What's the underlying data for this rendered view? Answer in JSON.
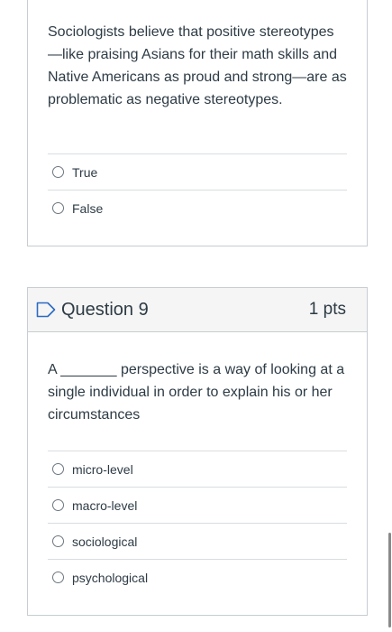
{
  "question8": {
    "text": "Sociologists believe that positive stereotypes —like praising Asians for their math skills and Native Americans as proud and strong—are as problematic as negative stereotypes.",
    "answers": [
      "True",
      "False"
    ]
  },
  "question9": {
    "title": "Question 9",
    "points": "1 pts",
    "text": "A _______ perspective is a way of looking at a single individual in order to explain his or her circumstances",
    "answers": [
      "micro-level",
      "macro-level",
      "sociological",
      "psychological"
    ]
  },
  "colors": {
    "flag": "#2d6bc4",
    "border": "#c7cdd1",
    "header_bg": "#f5f5f5",
    "text": "#2d3b45"
  }
}
